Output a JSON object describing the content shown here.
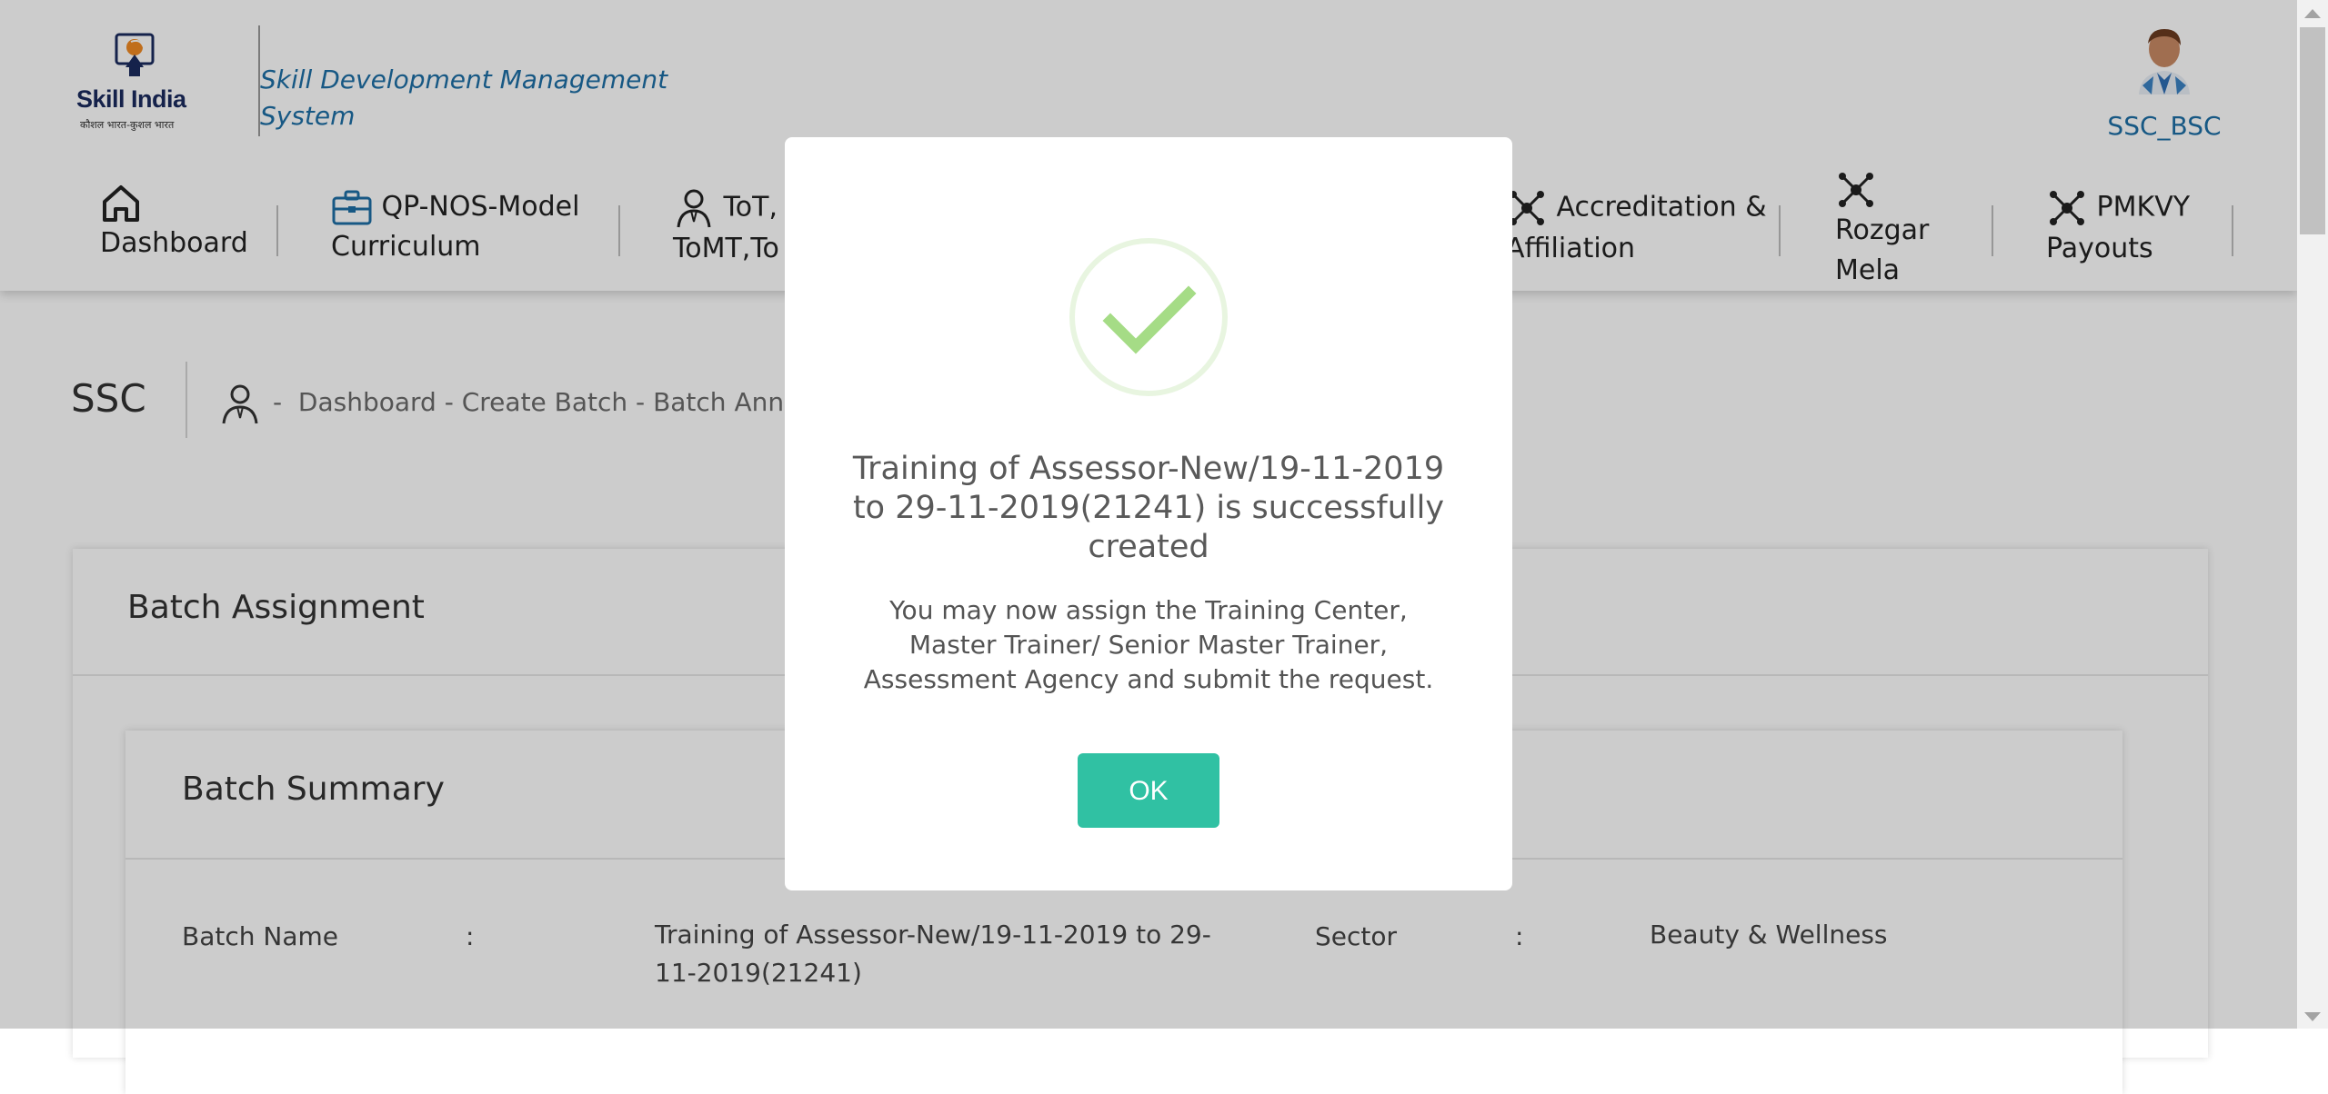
{
  "header": {
    "logo_text": "Skill India",
    "logo_subtext": "कौशल भारत-कुशल भारत",
    "app_title": "Skill Development Management System",
    "user_name": "SSC_BSC"
  },
  "nav": {
    "items": [
      {
        "label": "Dashboard",
        "icon": "home-icon"
      },
      {
        "label": "QP-NOS-Model Curriculum",
        "icon": "briefcase-icon"
      },
      {
        "label": "ToT, ToMT,To",
        "icon": "trainer-icon"
      },
      {
        "label": "Accreditation & Affiliation",
        "icon": "network-icon"
      },
      {
        "label": "Rozgar Mela",
        "icon": "network-icon"
      },
      {
        "label": "PMKVY Payouts",
        "icon": "network-icon"
      }
    ]
  },
  "page": {
    "section": "SSC",
    "breadcrumb_sep": "-",
    "breadcrumb": "Dashboard - Create Batch - Batch Announ",
    "card_title": "Batch Assignment",
    "summary_title": "Batch Summary",
    "rows": [
      {
        "label": "Batch Name",
        "colon": ":",
        "value": "Training of Assessor-New/19-11-2019 to 29-11-2019(21241)"
      },
      {
        "label": "Sector",
        "colon": ":",
        "value": "Beauty & Wellness"
      }
    ]
  },
  "modal": {
    "title": "Training of Assessor-New/19-11-2019 to 29-11-2019(21241) is successfully created",
    "message": "You may now assign the Training Center, Master Trainer/ Senior Master Trainer, Assessment Agency and submit the request.",
    "ok_label": "OK",
    "icon": "success-check-icon"
  },
  "colors": {
    "accent_blue": "#1d6fa5",
    "ok_button": "#30c1a3",
    "check_green": "#a5dc86"
  }
}
